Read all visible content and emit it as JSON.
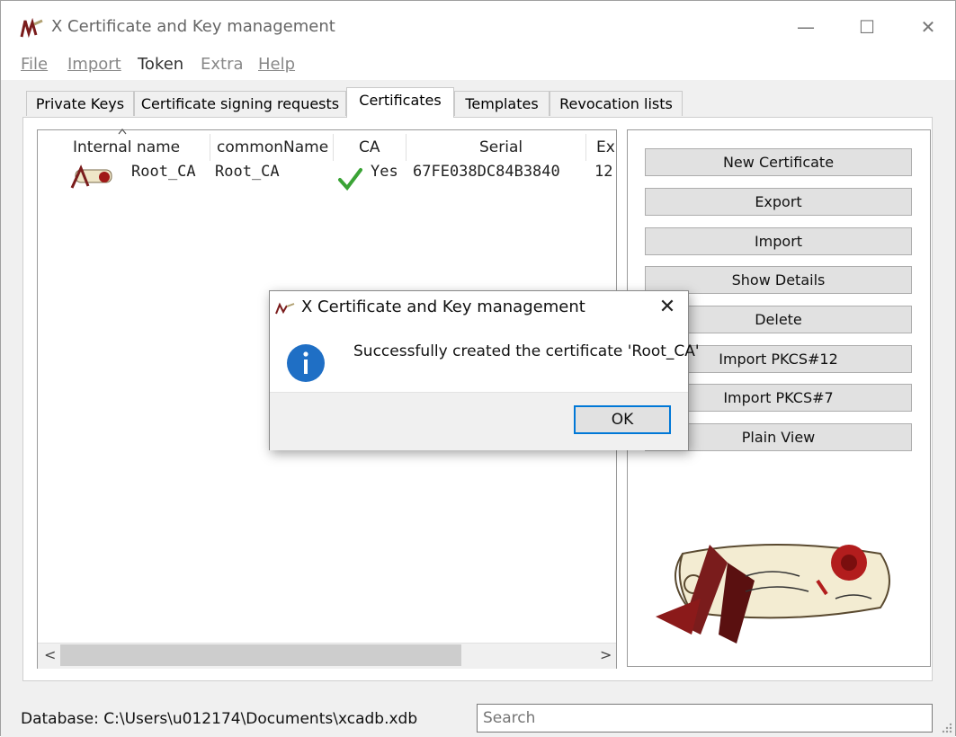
{
  "window": {
    "title": "X Certificate and Key management",
    "minimize": "—",
    "maximize": "☐",
    "close": "✕"
  },
  "menu": {
    "file": "File",
    "import": "Import",
    "token": "Token",
    "extra": "Extra",
    "help": "Help"
  },
  "tabs": [
    "Private Keys",
    "Certificate signing requests",
    "Certificates",
    "Templates",
    "Revocation lists"
  ],
  "selected_tab": "Certificates",
  "table": {
    "columns": [
      "Internal name",
      "commonName",
      "CA",
      "Serial",
      "Ex"
    ],
    "rows": [
      {
        "internal_name": "Root_CA",
        "common_name": "Root_CA",
        "ca": "Yes",
        "serial": "67FE038DC84B3840",
        "expiry": "12"
      }
    ]
  },
  "buttons": [
    "New Certificate",
    "Export",
    "Import",
    "Show Details",
    "Delete",
    "Import PKCS#12",
    "Import PKCS#7",
    "Plain View"
  ],
  "scroll": {
    "left": "<",
    "right": ">"
  },
  "status": {
    "database": "Database: C:\\Users\\u012174\\Documents\\xcadb.xdb",
    "search_placeholder": "Search"
  },
  "dialog": {
    "title": "X Certificate and Key management",
    "message": "Successfully created the certificate 'Root_CA'",
    "ok": "OK",
    "close": "✕"
  },
  "colors": {
    "accent": "#0078d7",
    "info_blue": "#1f6fc5",
    "check_green": "#3aa335",
    "seal_red": "#8b1a1a"
  }
}
